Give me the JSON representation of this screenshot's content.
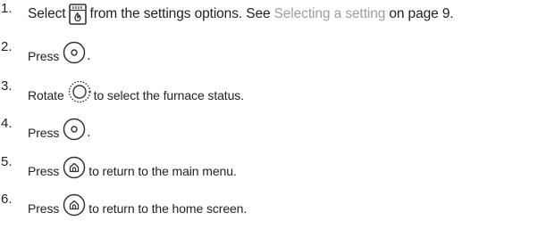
{
  "steps": [
    {
      "number": "1.",
      "pre": "Select",
      "icon": "furnace-icon",
      "post": "from the settings options. See",
      "link": "Selecting a setting",
      "tail": "on page 9."
    },
    {
      "number": "2.",
      "pre": "Press",
      "icon": "ok-button-icon",
      "post": "."
    },
    {
      "number": "3.",
      "pre": "Rotate",
      "icon": "rotary-dial-icon",
      "post": "to select the furnace status."
    },
    {
      "number": "4.",
      "pre": "Press",
      "icon": "ok-button-icon",
      "post": "."
    },
    {
      "number": "5.",
      "pre": "Press",
      "icon": "home-button-icon",
      "post": "to return to the main menu."
    },
    {
      "number": "6.",
      "pre": "Press",
      "icon": "home-button-icon",
      "post": "to return to the home screen."
    }
  ],
  "colors": {
    "text": "#222222",
    "link": "#9aa0a6",
    "icon_stroke": "#333333"
  }
}
